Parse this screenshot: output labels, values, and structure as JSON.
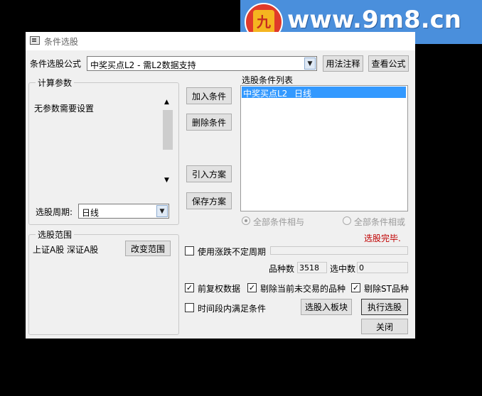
{
  "watermark": {
    "logo_char": "九",
    "text": "www.9m8.cn"
  },
  "window": {
    "title": "条件选股"
  },
  "formula": {
    "label": "条件选股公式",
    "selected": "中奖买点L2    - 需L2数据支持",
    "usage_button": "用法注释",
    "view_button": "查看公式"
  },
  "params": {
    "group_title": "计算参数",
    "no_params_text": "无参数需要设置",
    "period_label": "选股周期:",
    "period_value": "日线"
  },
  "middle_buttons": {
    "add": "加入条件",
    "delete": "删除条件",
    "import": "引入方案",
    "save": "保存方案"
  },
  "conditions": {
    "list_title": "选股条件列表",
    "items": [
      {
        "name": "中奖买点L2",
        "period": "日线"
      }
    ],
    "radio_and": "全部条件相与",
    "radio_or": "全部条件相或",
    "status": "选股完毕."
  },
  "scope": {
    "group_title": "选股范围",
    "markets": "上证A股  深证A股",
    "change_button": "改变范围"
  },
  "options": {
    "use_variable_period": "使用涨跌不定周期",
    "count_label": "品种数",
    "count_value": "3518",
    "selected_label": "选中数",
    "selected_value": "0",
    "adjusted_data": "前复权数据",
    "exclude_untraded": "剔除当前未交易的品种",
    "exclude_st": "剔除ST品种",
    "time_range": "时间段内满足条件"
  },
  "actions": {
    "to_block": "选股入板块",
    "execute": "执行选股",
    "close": "关闭"
  },
  "colors": {
    "status_red": "#c00000",
    "selection_blue": "#3399ff",
    "watermark_blue": "#4a8fdc"
  }
}
